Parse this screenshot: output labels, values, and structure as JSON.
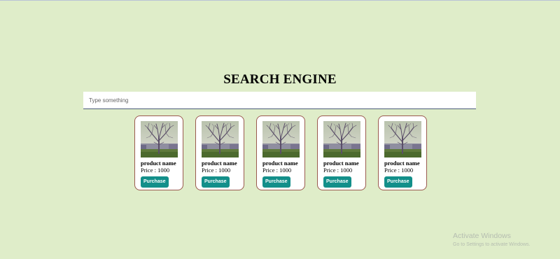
{
  "header": {
    "title": "SEARCH ENGINE"
  },
  "search": {
    "placeholder": "Type something",
    "value": ""
  },
  "products": [
    {
      "name": "product name",
      "price": "Price : 1000",
      "button": "Purchase"
    },
    {
      "name": "product name",
      "price": "Price : 1000",
      "button": "Purchase"
    },
    {
      "name": "product name",
      "price": "Price : 1000",
      "button": "Purchase"
    },
    {
      "name": "product name",
      "price": "Price : 1000",
      "button": "Purchase"
    },
    {
      "name": "product name",
      "price": "Price : 1000",
      "button": "Purchase"
    }
  ],
  "watermark": {
    "title": "Activate Windows",
    "subtitle": "Go to Settings to activate Windows."
  },
  "colors": {
    "background": "#dfedc9",
    "button": "#138f8a",
    "card_border": "#9b5a4f"
  }
}
